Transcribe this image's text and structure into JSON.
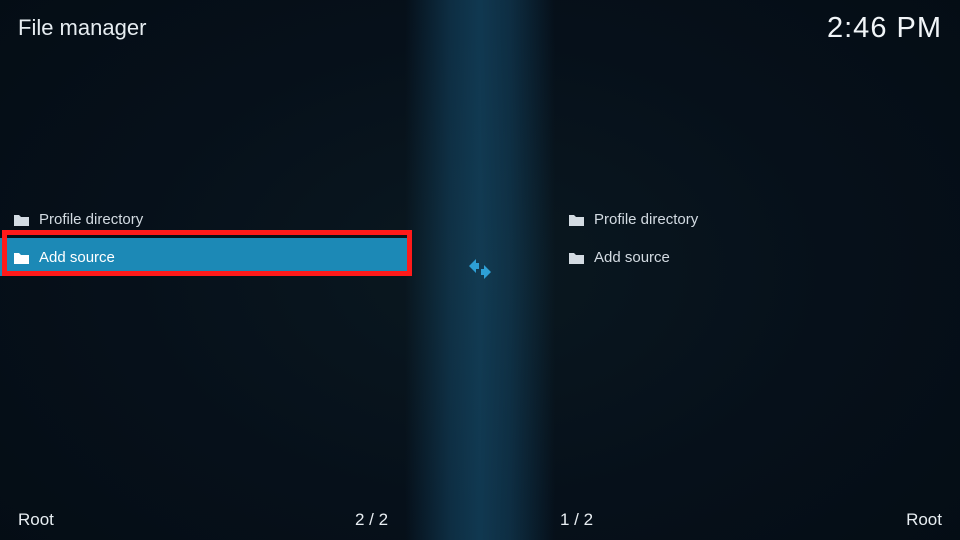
{
  "header": {
    "title": "File manager",
    "clock": "2:46 PM"
  },
  "panels": {
    "left": {
      "items": [
        {
          "label": "Profile directory"
        },
        {
          "label": "Add source"
        }
      ]
    },
    "right": {
      "items": [
        {
          "label": "Profile directory"
        },
        {
          "label": "Add source"
        }
      ]
    }
  },
  "footer": {
    "left_location": "Root",
    "left_counter": "2 / 2",
    "right_counter": "1 / 2",
    "right_location": "Root"
  },
  "colors": {
    "accent": "#1c89b6",
    "highlight_border": "#ff1a1a"
  }
}
